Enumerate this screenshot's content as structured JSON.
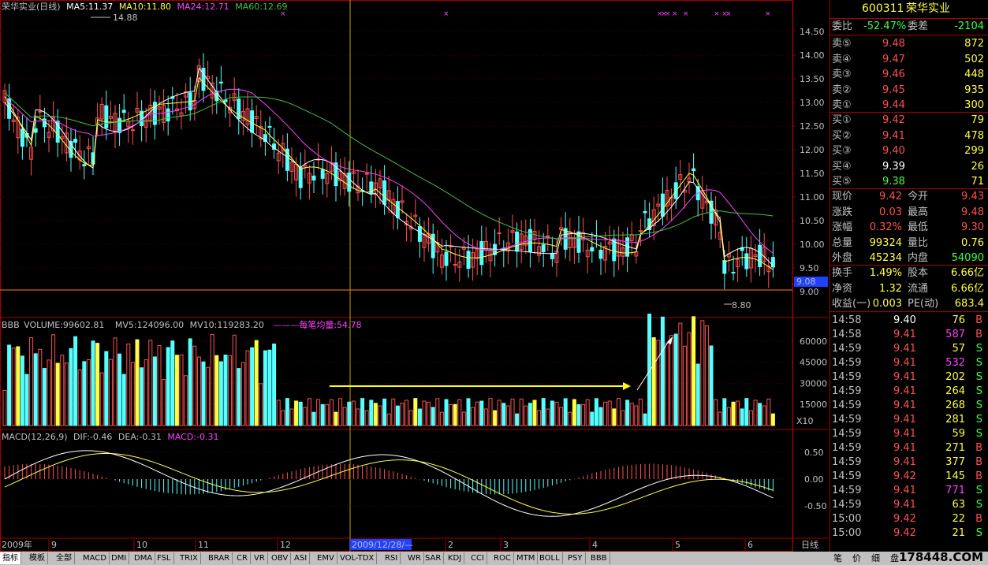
{
  "kline_header": {
    "name": "荣华实业(日线)",
    "ma5": "MA5:11.37",
    "ma10": "MA10:11.80",
    "ma24": "MA24:12.71",
    "ma60": "MA60:12.69",
    "high_mark": "14.88",
    "low_mark": "8.80",
    "current_price_tag": "9.08"
  },
  "price_axis": [
    "14.50",
    "14.00",
    "13.50",
    "13.00",
    "12.50",
    "12.00",
    "11.50",
    "11.00",
    "10.50",
    "10.00",
    "9.50",
    "9.00"
  ],
  "volume_header": {
    "indicator": "BBB",
    "volume": "VOLUME:99602.81",
    "mv5": "MV5:124096.00",
    "mv10": "MV10:119283.20",
    "avg": "每笔均量:54.78",
    "unit": "X10"
  },
  "volume_axis": [
    "60000",
    "45000",
    "30000",
    "15000"
  ],
  "macd_header": {
    "params": "MACD(12,26,9)",
    "dif": "DIF:-0.46",
    "dea": "DEA:-0.31",
    "macd": "MACD:-0.31"
  },
  "macd_axis": [
    "0.50",
    "0.00",
    "-0.50"
  ],
  "date_axis": {
    "year": "2009年",
    "months": [
      "9",
      "10",
      "11",
      "12",
      "2",
      "3",
      "4",
      "5",
      "6"
    ],
    "cursor_date": "2009/12/28/—",
    "period": "日线"
  },
  "quote": {
    "code": "600311",
    "name": "荣华实业",
    "ratio_label": "委比",
    "ratio_value": "-52.47%",
    "diff_label": "委差",
    "diff_value": "-2104",
    "asks": [
      {
        "label": "卖⑤",
        "price": "9.48",
        "vol": "872"
      },
      {
        "label": "卖④",
        "price": "9.47",
        "vol": "502"
      },
      {
        "label": "卖③",
        "price": "9.46",
        "vol": "448"
      },
      {
        "label": "卖②",
        "price": "9.45",
        "vol": "935"
      },
      {
        "label": "卖①",
        "price": "9.44",
        "vol": "300"
      }
    ],
    "bids": [
      {
        "label": "买①",
        "price": "9.42",
        "vol": "79"
      },
      {
        "label": "买②",
        "price": "9.41",
        "vol": "478"
      },
      {
        "label": "买③",
        "price": "9.40",
        "vol": "299"
      },
      {
        "label": "买④",
        "price": "9.39",
        "vol": "26"
      },
      {
        "label": "买⑤",
        "price": "9.38",
        "vol": "71"
      }
    ],
    "stats": [
      {
        "l1": "现价",
        "v1": "9.42",
        "l2": "今开",
        "v2": "9.43"
      },
      {
        "l1": "涨跌",
        "v1": "0.03",
        "l2": "最高",
        "v2": "9.48"
      },
      {
        "l1": "涨幅",
        "v1": "0.32%",
        "l2": "最低",
        "v2": "9.30"
      },
      {
        "l1": "总量",
        "v1": "99324",
        "l2": "量比",
        "v2": "0.76"
      },
      {
        "l1": "外盘",
        "v1": "45234",
        "l2": "内盘",
        "v2": "54090"
      }
    ],
    "stats2": [
      {
        "l1": "换手",
        "v1": "1.49%",
        "l2": "股本",
        "v2": "6.66亿"
      },
      {
        "l1": "净资",
        "v1": "1.32",
        "l2": "流通",
        "v2": "6.66亿"
      },
      {
        "l1": "收益(一)",
        "v1": "0.003",
        "l2": "PE(动)",
        "v2": "683.4"
      }
    ],
    "ticks": [
      {
        "t": "14:58",
        "p": "9.40",
        "v": "76",
        "s": "B"
      },
      {
        "t": "14:58",
        "p": "9.41",
        "v": "587",
        "s": "B"
      },
      {
        "t": "14:59",
        "p": "9.41",
        "v": "57",
        "s": "S"
      },
      {
        "t": "14:59",
        "p": "9.41",
        "v": "532",
        "s": "S"
      },
      {
        "t": "14:59",
        "p": "9.41",
        "v": "202",
        "s": "S"
      },
      {
        "t": "14:59",
        "p": "9.41",
        "v": "264",
        "s": "S"
      },
      {
        "t": "14:59",
        "p": "9.41",
        "v": "268",
        "s": "S"
      },
      {
        "t": "14:59",
        "p": "9.41",
        "v": "281",
        "s": "S"
      },
      {
        "t": "14:59",
        "p": "9.41",
        "v": "59",
        "s": "S"
      },
      {
        "t": "14:59",
        "p": "9.41",
        "v": "271",
        "s": "B"
      },
      {
        "t": "14:59",
        "p": "9.41",
        "v": "377",
        "s": "B"
      },
      {
        "t": "14:59",
        "p": "9.42",
        "v": "145",
        "s": "B"
      },
      {
        "t": "14:59",
        "p": "9.41",
        "v": "771",
        "s": "S"
      },
      {
        "t": "14:59",
        "p": "9.41",
        "v": "63",
        "s": "S"
      },
      {
        "t": "15:00",
        "p": "9.42",
        "v": "22",
        "s": "B"
      },
      {
        "t": "15:00",
        "p": "9.42",
        "v": "21",
        "s": "S"
      }
    ]
  },
  "tabs": [
    "指标",
    "模板",
    "全部",
    "MACD",
    "DMI",
    "DMA",
    "FSL",
    "TRIX",
    "BRAR",
    "CR",
    "VR",
    "OBV",
    "ASI",
    "EMV",
    "VOL-TDX",
    "RSI",
    "WR",
    "SAR",
    "KDJ",
    "CCI",
    "ROC",
    "MTM",
    "BOLL",
    "PSY",
    "BBB"
  ],
  "right_tabs": [
    "笔",
    "价",
    "细",
    "盘"
  ],
  "watermark": "178448.COM",
  "colors": {
    "up": "#ff5050",
    "down": "#54ffff",
    "ma5": "#ffffff",
    "ma10": "#ffff40",
    "ma24": "#ff40ff",
    "ma60": "#40c040",
    "accent": "#ffff00",
    "grid": "#a00000"
  }
}
